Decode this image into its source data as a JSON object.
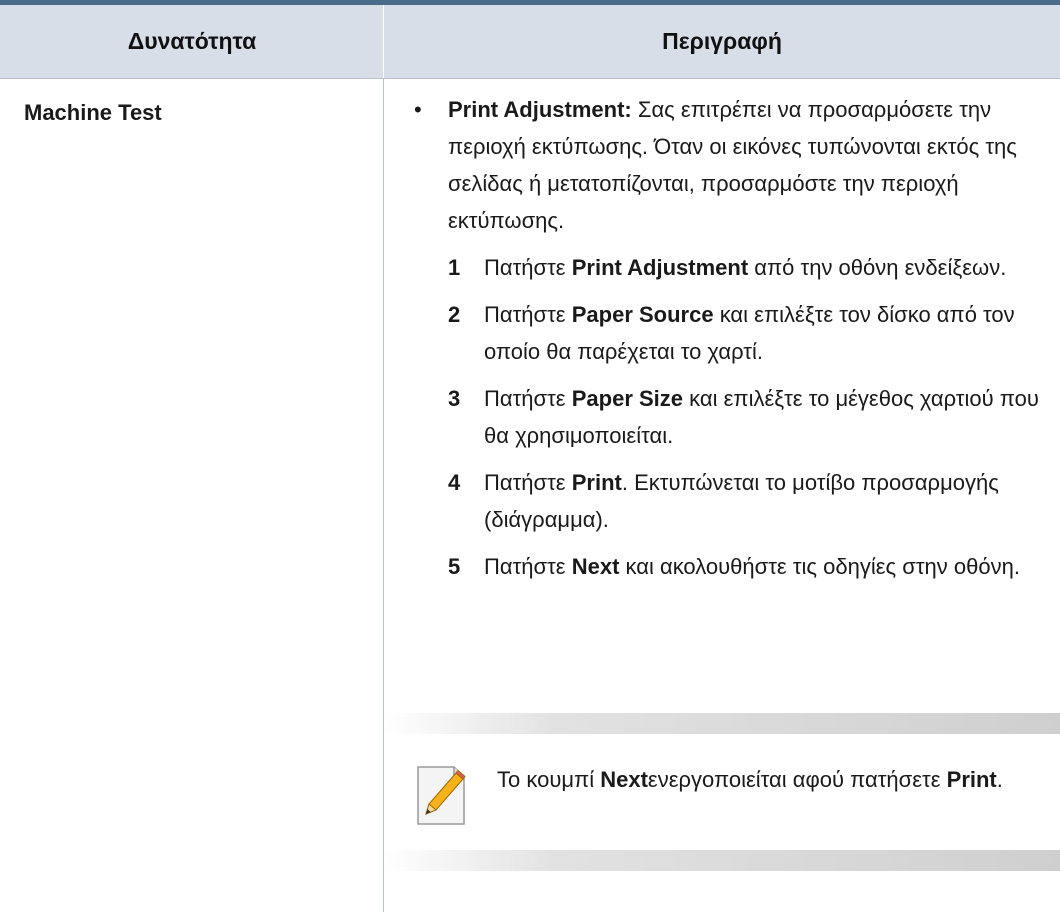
{
  "table": {
    "headers": [
      "Δυνατότητα",
      "Περιγραφή"
    ],
    "feature": "Machine Test"
  },
  "description": {
    "intro_bold": "Print Adjustment:",
    "intro_text": " Σας επιτρέπει να προσαρμόσετε την περιοχή εκτύπωσης. Όταν οι εικόνες τυπώνονται εκτός της σελίδας ή μετατοπίζονται, προσαρμόστε την περιοχή εκτύπωσης.",
    "steps": [
      {
        "num": "1",
        "pre": "Πατήστε ",
        "bold": "Print Adjustment",
        "post": " από την οθόνη ενδείξεων."
      },
      {
        "num": "2",
        "pre": "Πατήστε ",
        "bold": "Paper Source",
        "post": " και επιλέξτε τον δίσκο από τον οποίο θα παρέχεται το χαρτί."
      },
      {
        "num": "3",
        "pre": "Πατήστε ",
        "bold": "Paper Size",
        "post": " και επιλέξτε το μέγεθος χαρτιού που θα χρησιμοποιείται."
      },
      {
        "num": "4",
        "pre": "Πατήστε ",
        "bold": "Print",
        "post": ". Εκτυπώνεται το μοτίβο προσαρμογής (διάγραμμα)."
      },
      {
        "num": "5",
        "pre": "Πατήστε ",
        "bold": "Next",
        "post": " και ακολουθήστε τις οδηγίες στην οθόνη."
      }
    ]
  },
  "note": {
    "icon": "note-pencil-icon",
    "part1": "Το κουμπί ",
    "bold1": "Next",
    "part2": "ενεργοποιείται αφού πατήσετε ",
    "bold2": "Print",
    "part3": "."
  },
  "colors": {
    "header_bg": "#d8dee7",
    "top_rule": "#4a6b8a",
    "note_pencil": "#f5b21a"
  }
}
